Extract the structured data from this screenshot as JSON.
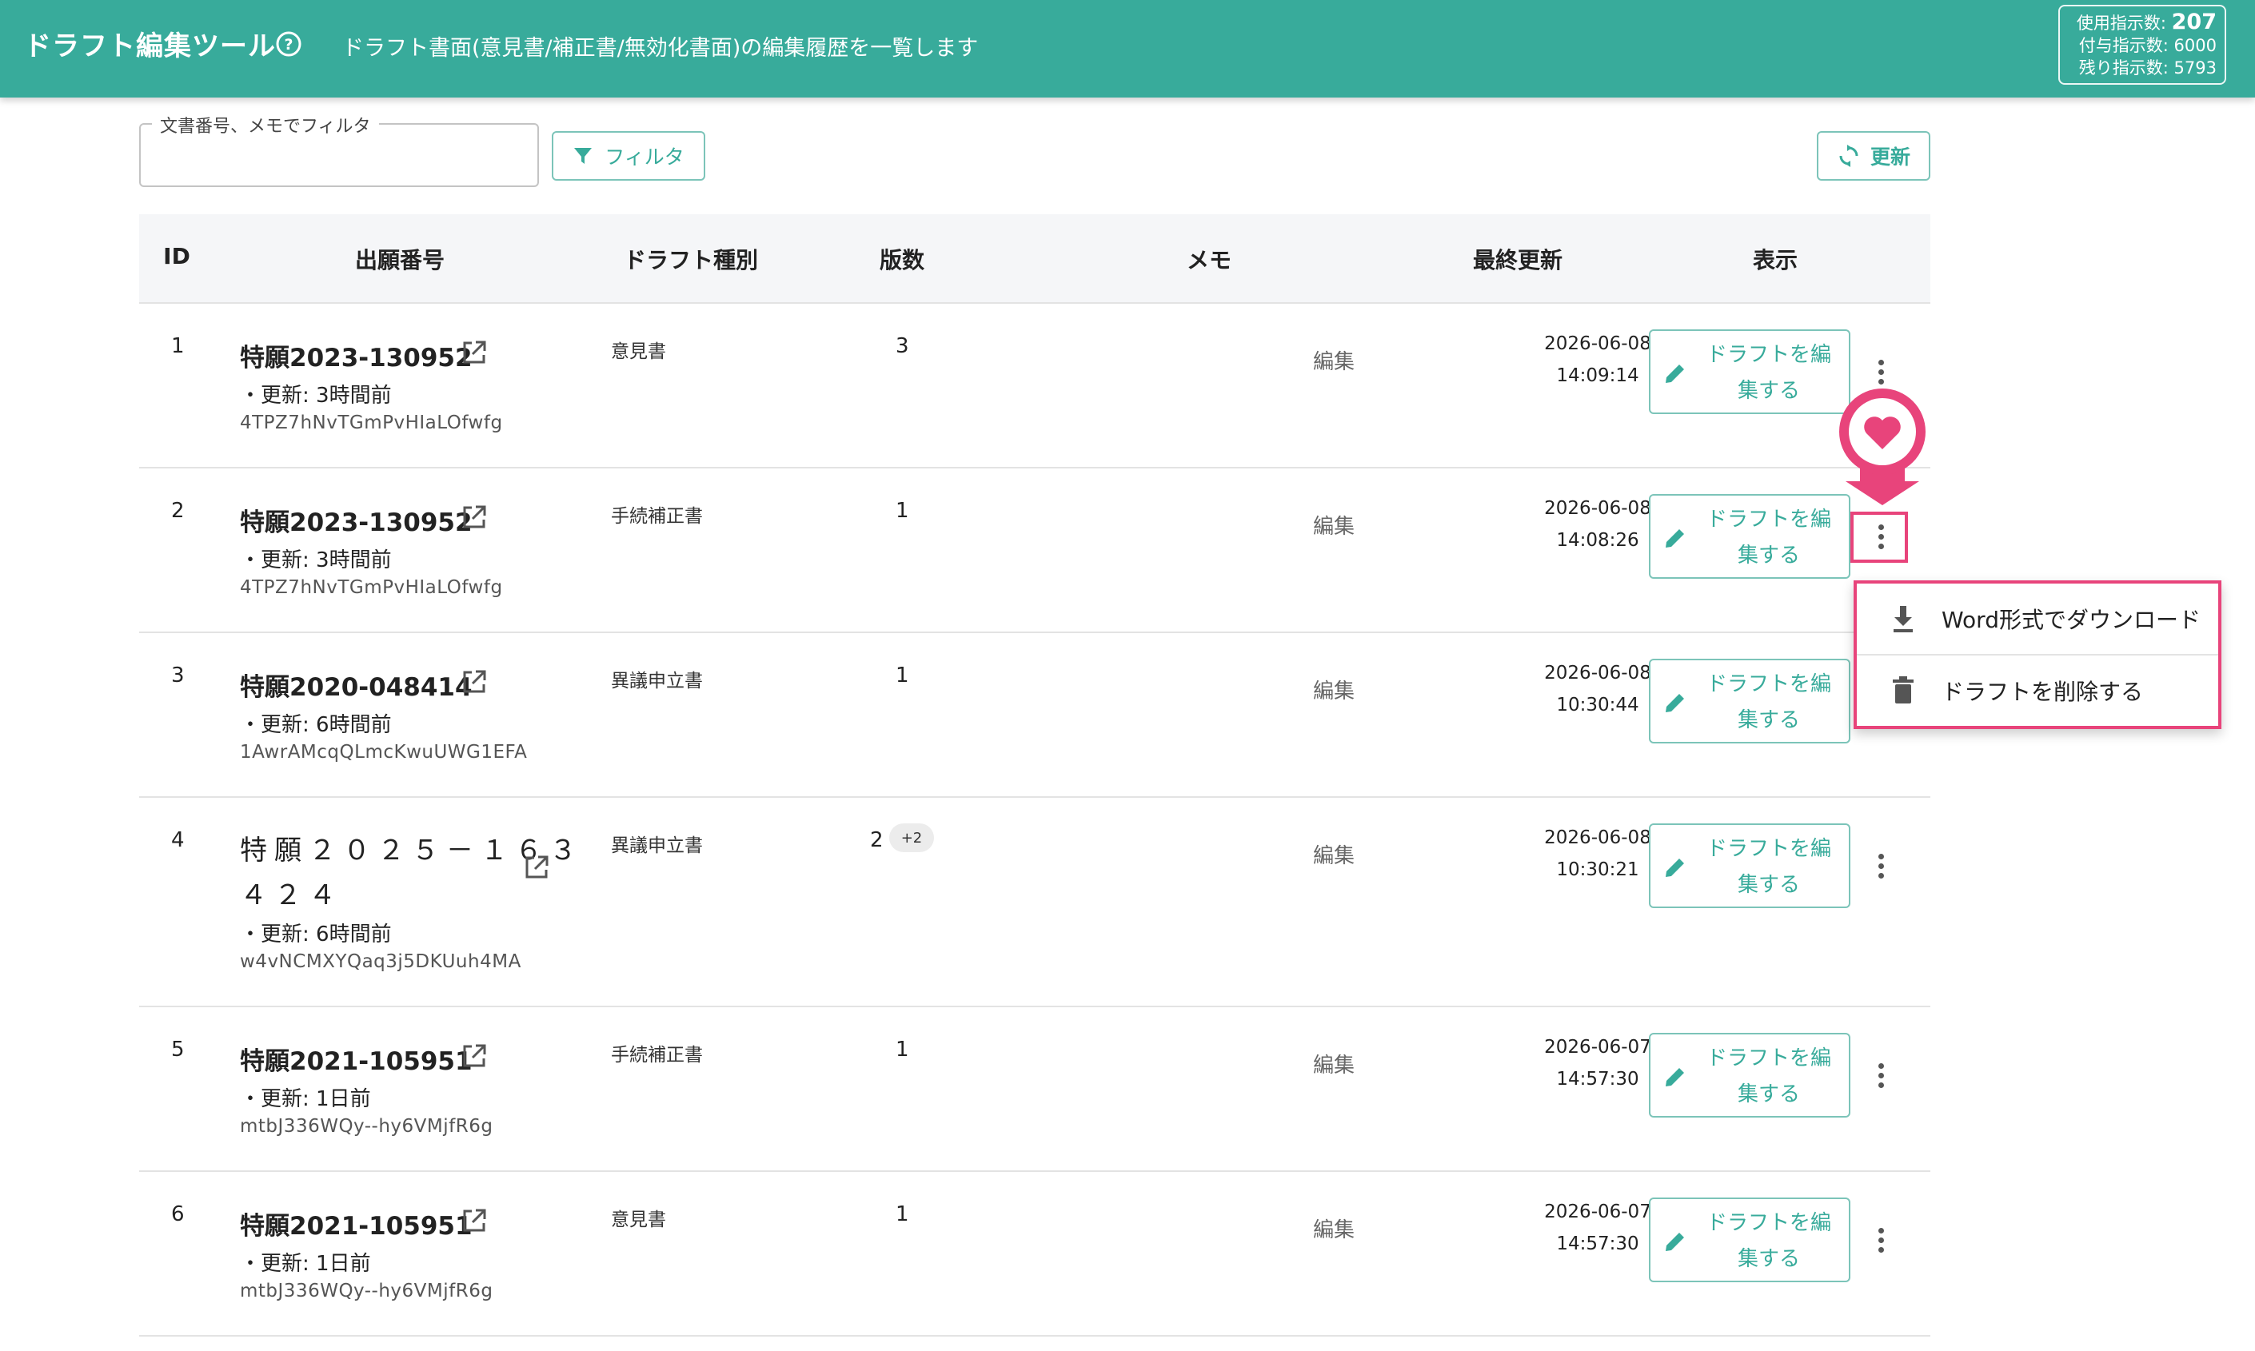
{
  "header": {
    "title": "ドラフト編集ツール",
    "subtitle": "ドラフト書面(意見書/補正書/無効化書面)の編集履歴を一覧します",
    "usage": {
      "used_label": "使用指示数:",
      "used_value": "207",
      "granted": "付与指示数: 6000",
      "remaining": "残り指示数: 5793"
    }
  },
  "toolbar": {
    "filter_label": "文書番号、メモでフィルタ",
    "filter_value": "",
    "filter_button": "フィルタ",
    "refresh_button": "更新"
  },
  "table": {
    "headers": {
      "id": "ID",
      "application_number": "出願番号",
      "draft_type": "ドラフト種別",
      "versions": "版数",
      "memo": "メモ",
      "last_updated": "最終更新",
      "display": "表示"
    },
    "rows": [
      {
        "id": "1",
        "application_number": "特願2023-130952",
        "updated": "・更新: 3時間前",
        "hash": "4TPZ7hNvTGmPvHIaLOfwfg",
        "draft_type": "意見書",
        "versions": "3",
        "version_chip": "",
        "memo": "編集",
        "date": "2026-06-08",
        "time": "14:09:14",
        "edit_line1": "ドラフトを編",
        "edit_line2": "集する"
      },
      {
        "id": "2",
        "application_number": "特願2023-130952",
        "updated": "・更新: 3時間前",
        "hash": "4TPZ7hNvTGmPvHIaLOfwfg",
        "draft_type": "手続補正書",
        "versions": "1",
        "version_chip": "",
        "memo": "編集",
        "date": "2026-06-08",
        "time": "14:08:26",
        "edit_line1": "ドラフトを編",
        "edit_line2": "集する"
      },
      {
        "id": "3",
        "application_number": "特願2020-048414",
        "updated": "・更新: 6時間前",
        "hash": "1AwrAMcqQLmcKwuUWG1EFA",
        "draft_type": "異議申立書",
        "versions": "1",
        "version_chip": "",
        "memo": "編集",
        "date": "2026-06-08",
        "time": "10:30:44",
        "edit_line1": "ドラフトを編",
        "edit_line2": "集する"
      },
      {
        "id": "4",
        "application_number_line1": "特願２０２５－１６３",
        "application_number_line2": "４２４",
        "updated": "・更新: 6時間前",
        "hash": "w4vNCMXYQaq3j5DKUuh4MA",
        "draft_type": "異議申立書",
        "versions": "2",
        "version_chip": "+2",
        "memo": "編集",
        "date": "2026-06-08",
        "time": "10:30:21",
        "edit_line1": "ドラフトを編",
        "edit_line2": "集する"
      },
      {
        "id": "5",
        "application_number": "特願2021-105951",
        "updated": "・更新: 1日前",
        "hash": "mtbJ336WQy--hy6VMjfR6g",
        "draft_type": "手続補正書",
        "versions": "1",
        "version_chip": "",
        "memo": "編集",
        "date": "2026-06-07",
        "time": "14:57:30",
        "edit_line1": "ドラフトを編",
        "edit_line2": "集する"
      },
      {
        "id": "6",
        "application_number": "特願2021-105951",
        "updated": "・更新: 1日前",
        "hash": "mtbJ336WQy--hy6VMjfR6g",
        "draft_type": "意見書",
        "versions": "1",
        "version_chip": "",
        "memo": "編集",
        "date": "2026-06-07",
        "time": "14:57:30",
        "edit_line1": "ドラフトを編",
        "edit_line2": "集する"
      }
    ]
  },
  "row_menu": {
    "items": [
      {
        "label": "Word形式でダウンロード",
        "icon": "download-icon"
      },
      {
        "label": "ドラフトを削除する",
        "icon": "trash-icon"
      }
    ]
  },
  "colors": {
    "header_bg": "#38ab9b",
    "accent": "#38ab9b",
    "highlight": "#e8447b"
  }
}
